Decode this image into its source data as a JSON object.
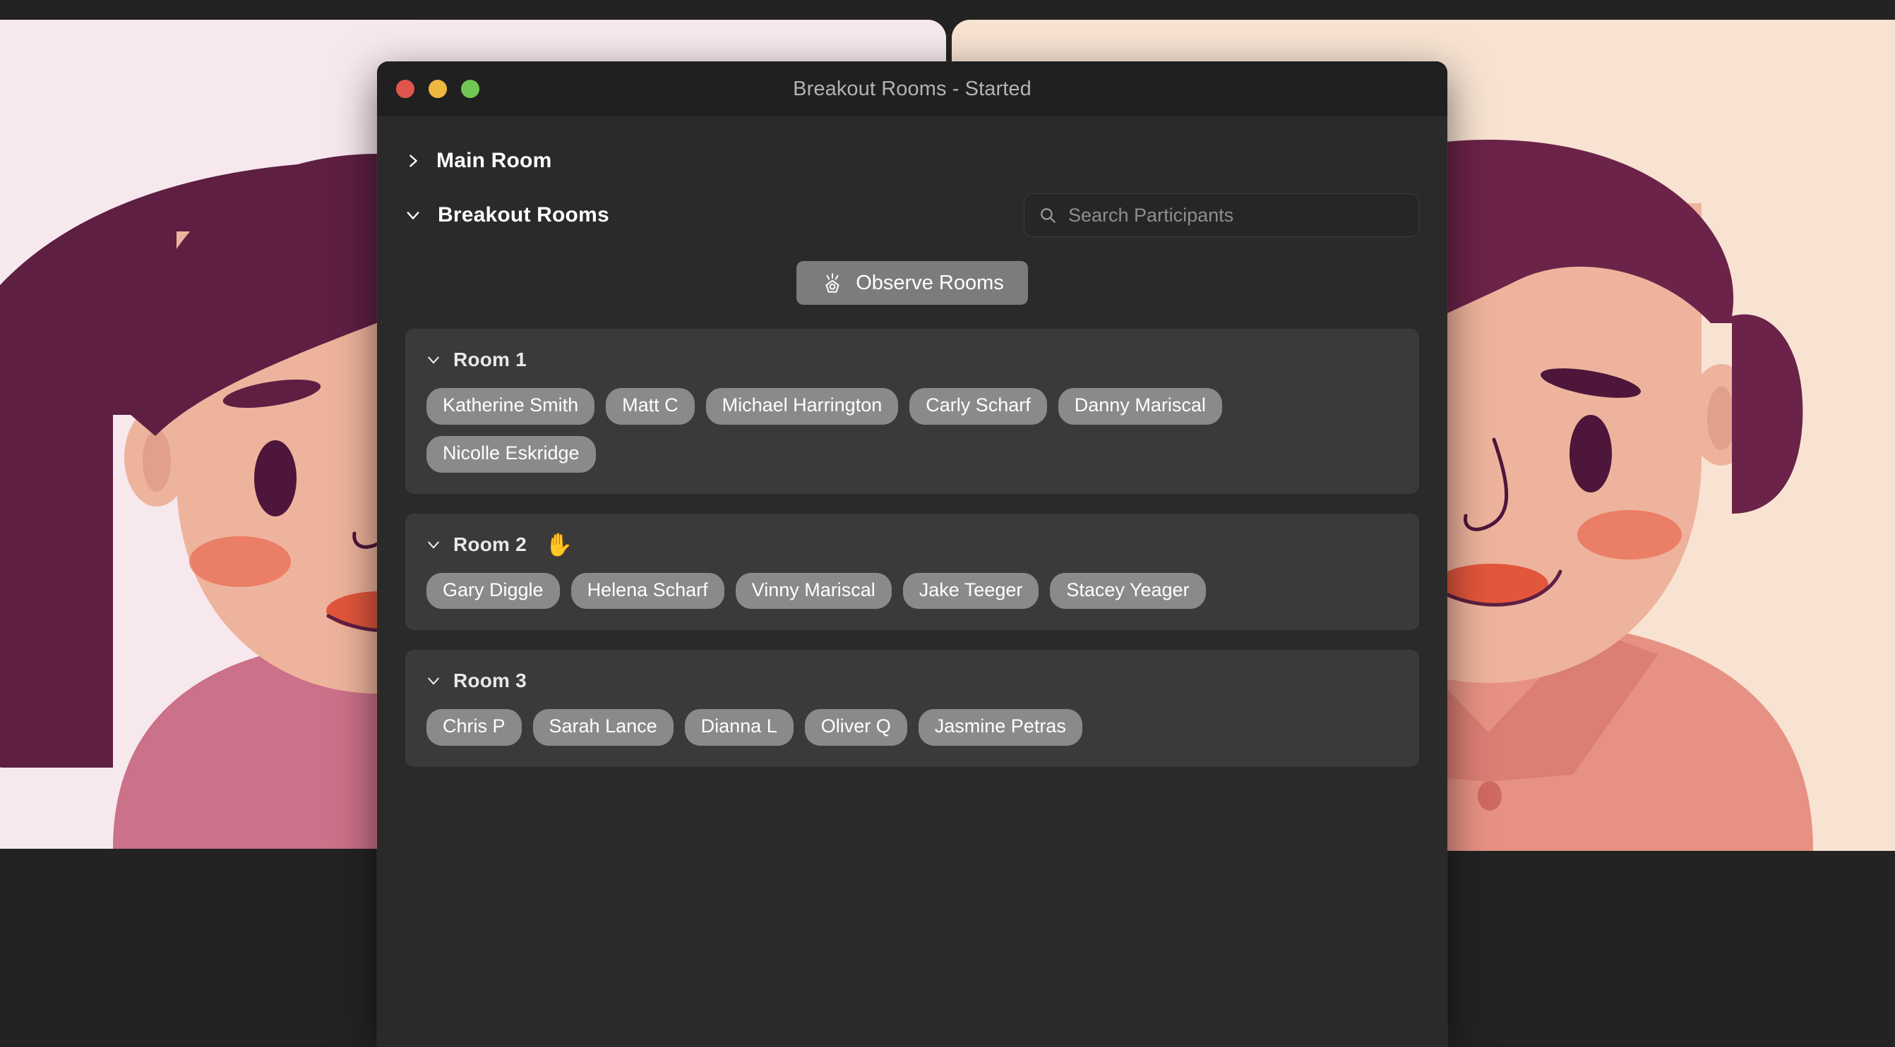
{
  "window": {
    "title": "Breakout Rooms - Started",
    "traffic_lights": {
      "close": "close-button-red",
      "minimize": "minimize-button-yellow",
      "zoom": "zoom-button-green"
    },
    "colors": {
      "titlebar_bg": "#202020",
      "body_bg": "#2a2a2a",
      "card_bg": "#3a3a3a",
      "chip_bg": "#8a8a8a",
      "button_bg": "#7c7c7c",
      "red": "#e0564f",
      "yellow": "#edb740",
      "green": "#72c653"
    }
  },
  "sections": {
    "main_room": {
      "label": "Main Room",
      "chevron": "chevron-right-icon",
      "expanded": false
    },
    "breakout_rooms": {
      "label": "Breakout Rooms",
      "chevron": "chevron-down-icon",
      "expanded": true
    }
  },
  "search": {
    "placeholder": "Search Participants",
    "value": "",
    "icon": "search-icon"
  },
  "observe": {
    "label": "Observe Rooms",
    "icon": "eye-observe-icon"
  },
  "rooms": [
    {
      "name": "Room 1",
      "chevron": "chevron-down-icon",
      "badge": "",
      "participants": [
        "Katherine Smith",
        "Matt C",
        "Michael Harrington",
        "Carly Scharf",
        "Danny Mariscal",
        "Nicolle Eskridge"
      ]
    },
    {
      "name": "Room 2",
      "chevron": "chevron-down-icon",
      "badge": "✋",
      "participants": [
        "Gary Diggle",
        "Helena Scharf",
        "Vinny Mariscal",
        "Jake Teeger",
        "Stacey Yeager"
      ]
    },
    {
      "name": "Room 3",
      "chevron": "chevron-down-icon",
      "badge": "",
      "participants": [
        "Chris P",
        "Sarah Lance",
        "Dianna L",
        "Oliver Q",
        "Jasmine Petras"
      ]
    }
  ],
  "background": {
    "tiles": [
      {
        "id": "participant-video-left",
        "description": "illustrated-woman-avatar",
        "bg_color": "#f7e8ed",
        "hair_color": "#5e1f43",
        "skin_color": "#eeb39c",
        "shirt_color": "#cb7189"
      },
      {
        "id": "participant-video-right",
        "description": "illustrated-man-avatar",
        "bg_color": "#f8e3d2",
        "hair_color": "#6b2349",
        "skin_color": "#eeb39c",
        "shirt_color": "#e79184"
      }
    ]
  }
}
